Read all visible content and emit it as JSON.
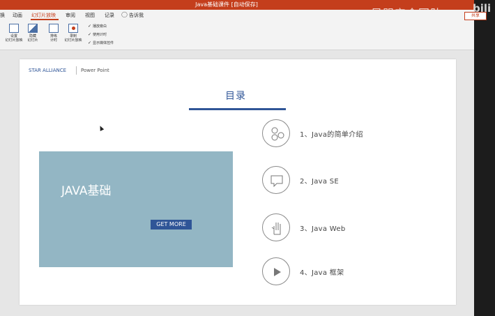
{
  "window": {
    "title": "Java基础课件 [自动保存]"
  },
  "ribbon": {
    "tabs": [
      {
        "label": "换"
      },
      {
        "label": "动画"
      },
      {
        "label": "幻灯片放映"
      },
      {
        "label": "审阅"
      },
      {
        "label": "视图"
      },
      {
        "label": "记录"
      }
    ],
    "tell_me": "告诉我",
    "share_label": "共享",
    "buttons": [
      {
        "label": "设置\n幻灯片放映"
      },
      {
        "label": "隐藏\n幻灯片"
      },
      {
        "label": "排练\n计时"
      },
      {
        "label": "录制\n幻灯片放映"
      }
    ],
    "checkboxes": [
      {
        "label": "播放旁白",
        "checked": true
      },
      {
        "label": "使用计时",
        "checked": true
      },
      {
        "label": "显示媒体控件",
        "checked": true
      }
    ]
  },
  "watermark": {
    "text": "星盟安全团队",
    "site": "bili"
  },
  "slide": {
    "brand": "STAR ALLIANCE",
    "app_name": "Power Point",
    "toc_title": "目录",
    "hero_title": "JAVA基础",
    "hero_button": "GET MORE",
    "items": [
      {
        "label": "1、Java的简单介绍",
        "icon": "network-icon"
      },
      {
        "label": "2、Java SE",
        "icon": "chat-icon"
      },
      {
        "label": "3、Java Web",
        "icon": "hand-icon"
      },
      {
        "label": "4、Java 框架",
        "icon": "play-icon"
      }
    ]
  },
  "colors": {
    "accent": "#c43e1c",
    "brand_blue": "#2f5597",
    "hero_bg": "#93b6c4"
  }
}
